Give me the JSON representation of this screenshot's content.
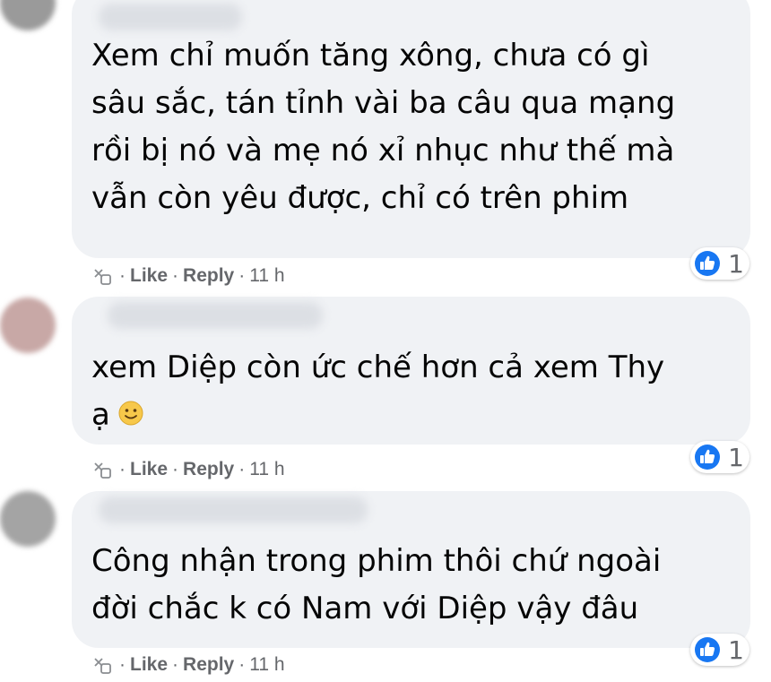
{
  "comments": [
    {
      "text": "Xem chỉ muốn tăng xông, chưa có gì\nsâu sắc, tán tỉnh vài ba câu qua mạng\nrồi bị nó và mẹ nó xỉ nhục như thế mà\nvẫn còn yêu được, chỉ có trên phim",
      "has_emoji": false,
      "reaction_icon": "like-icon",
      "reaction_count": "1",
      "like_label": "Like",
      "reply_label": "Reply",
      "separator": "·",
      "time": "11 h"
    },
    {
      "text": "xem Diệp còn ức chế hơn cả xem Thy\nạ",
      "has_emoji": true,
      "reaction_icon": "like-icon",
      "reaction_count": "1",
      "like_label": "Like",
      "reply_label": "Reply",
      "separator": "·",
      "time": "11 h"
    },
    {
      "text": "Công nhận trong phim thôi chứ ngoài\nđời chắc k có Nam với Diệp vậy đâu",
      "has_emoji": false,
      "reaction_icon": "like-icon",
      "reaction_count": "1",
      "like_label": "Like",
      "reply_label": "Reply",
      "separator": "·",
      "time": "11 h"
    }
  ],
  "colors": {
    "bubble": "#f0f2f5",
    "meta_text": "#65676b",
    "like_blue": "#1877f2"
  }
}
